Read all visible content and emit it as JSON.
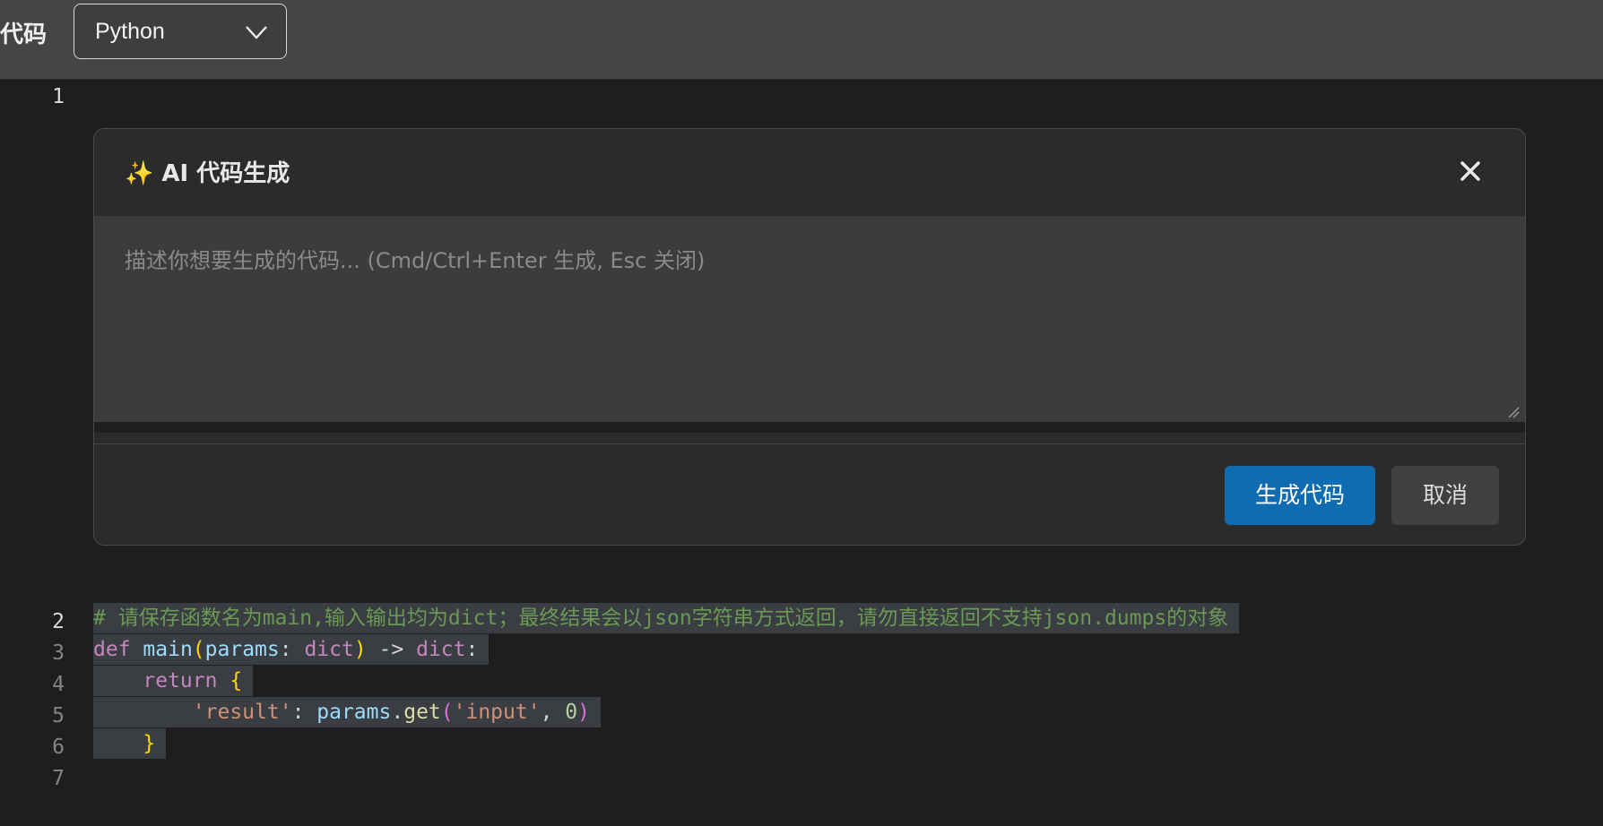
{
  "toolbar": {
    "label": "代码",
    "language_select": {
      "value": "Python"
    }
  },
  "editor": {
    "line_numbers": [
      "1",
      "2",
      "3",
      "4",
      "5",
      "6",
      "7"
    ],
    "lines": {
      "l2": {
        "comment": "# 请保存函数名为main,输入输出均为dict；最终结果会以json字符串方式返回，请勿直接返回不支持json.dumps的对象"
      },
      "l3": {
        "kw": "def",
        "fn": "main",
        "open": "(",
        "param": "params",
        "colon": ": ",
        "type1": "dict",
        "close": ")",
        "arrow": " -> ",
        "type2": "dict",
        "end": ":"
      },
      "l4": {
        "indent": "    ",
        "kw": "return",
        "brace": "{"
      },
      "l5": {
        "indent": "        ",
        "key": "'result'",
        "colon": ": ",
        "obj": "params",
        "dot": ".",
        "method": "get",
        "open": "(",
        "arg1": "'input'",
        "comma": ", ",
        "arg2": "0",
        "close": ")"
      },
      "l6": {
        "indent": "    ",
        "brace": "}"
      }
    }
  },
  "dialog": {
    "title": "✨ AI 代码生成",
    "close_icon": "close-icon",
    "prompt_placeholder": "描述你想要生成的代码... (Cmd/Ctrl+Enter 生成, Esc 关闭)",
    "generate_button": "生成代码",
    "cancel_button": "取消"
  },
  "colors": {
    "primary_button": "#0f6cb0",
    "editor_background": "#1e1e1e",
    "selection": "#3a3d41"
  }
}
